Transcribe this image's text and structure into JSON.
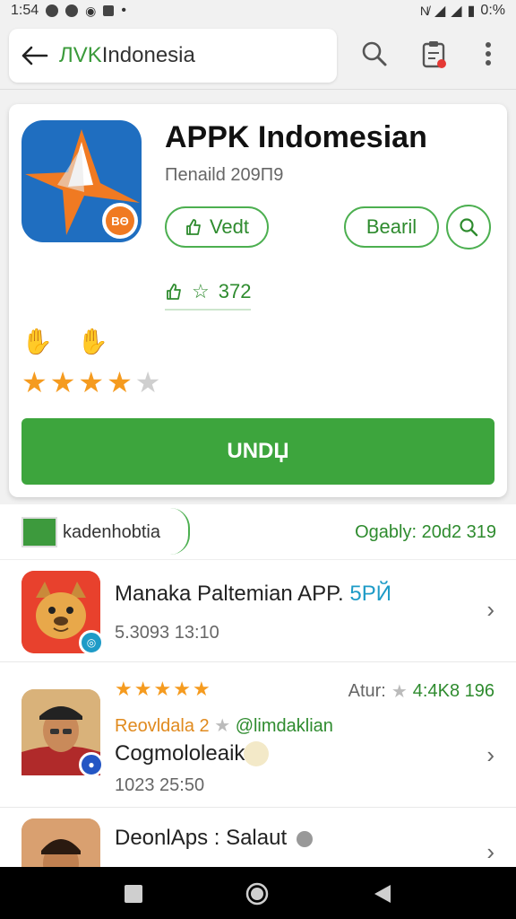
{
  "status_bar": {
    "time": "1:54",
    "battery": "0:%"
  },
  "app_bar": {
    "brand_prefix": "ЛVK",
    "brand_name": "Indonesia"
  },
  "app_card": {
    "title": "APPK Indomesian",
    "subtitle": "Πenaild 209Π9",
    "btn_vedt_label": "Vedt",
    "btn_bearil_label": "Bearil",
    "likes_count": "372",
    "rating": 4,
    "rating_max": 5,
    "icon_badge": "ΒΘ",
    "download_label": "UNDЏ"
  },
  "list": {
    "header_label": "kadenhobtia",
    "header_right": "Ogably: 20d2 319",
    "items": [
      {
        "title": "Manaka Paltemian APP.",
        "title_accent": "5PЙ",
        "meta": "5.3093 13:10"
      },
      {
        "stars": 5,
        "rating_label": "Atur:",
        "rating_value": "4:4K8 196",
        "sub_orange": "Reovldala 2",
        "sub_green": "@limdaklian",
        "title": "Cogmololeaik",
        "meta": "1023 25:50"
      },
      {
        "title": "DeonlAps : Salaut"
      }
    ]
  },
  "colors": {
    "brand_green": "#3da53d",
    "star_orange": "#f59b1f",
    "accent_blue": "#1e9bc7",
    "icon_blue": "#1f6ec0",
    "icon_orange": "#f07a22"
  }
}
